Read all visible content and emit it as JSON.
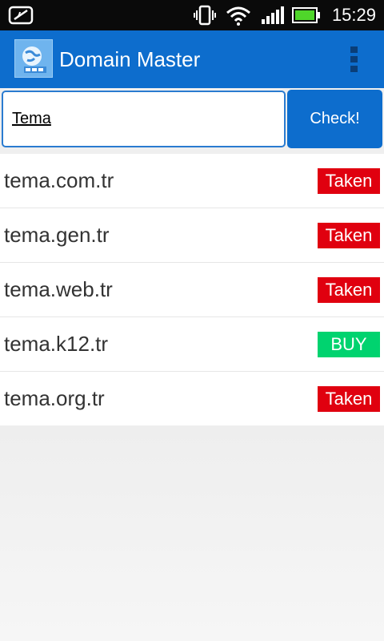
{
  "status_bar": {
    "time": "15:29",
    "icons": [
      "notification-icon",
      "vibrate-icon",
      "wifi-icon",
      "signal-icon",
      "battery-icon"
    ]
  },
  "app": {
    "title": "Domain Master",
    "logo_icon": "globe-www-icon"
  },
  "search": {
    "value": "Tema",
    "check_label": "Check!"
  },
  "results": [
    {
      "domain": "tema.com.tr",
      "status": "Taken",
      "kind": "taken"
    },
    {
      "domain": "tema.gen.tr",
      "status": "Taken",
      "kind": "taken"
    },
    {
      "domain": "tema.web.tr",
      "status": "Taken",
      "kind": "taken"
    },
    {
      "domain": "tema.k12.tr",
      "status": "BUY",
      "kind": "buy"
    },
    {
      "domain": "tema.org.tr",
      "status": "Taken",
      "kind": "taken"
    }
  ],
  "colors": {
    "primary": "#0d6dcd",
    "taken": "#e0000f",
    "buy": "#00d36f"
  }
}
